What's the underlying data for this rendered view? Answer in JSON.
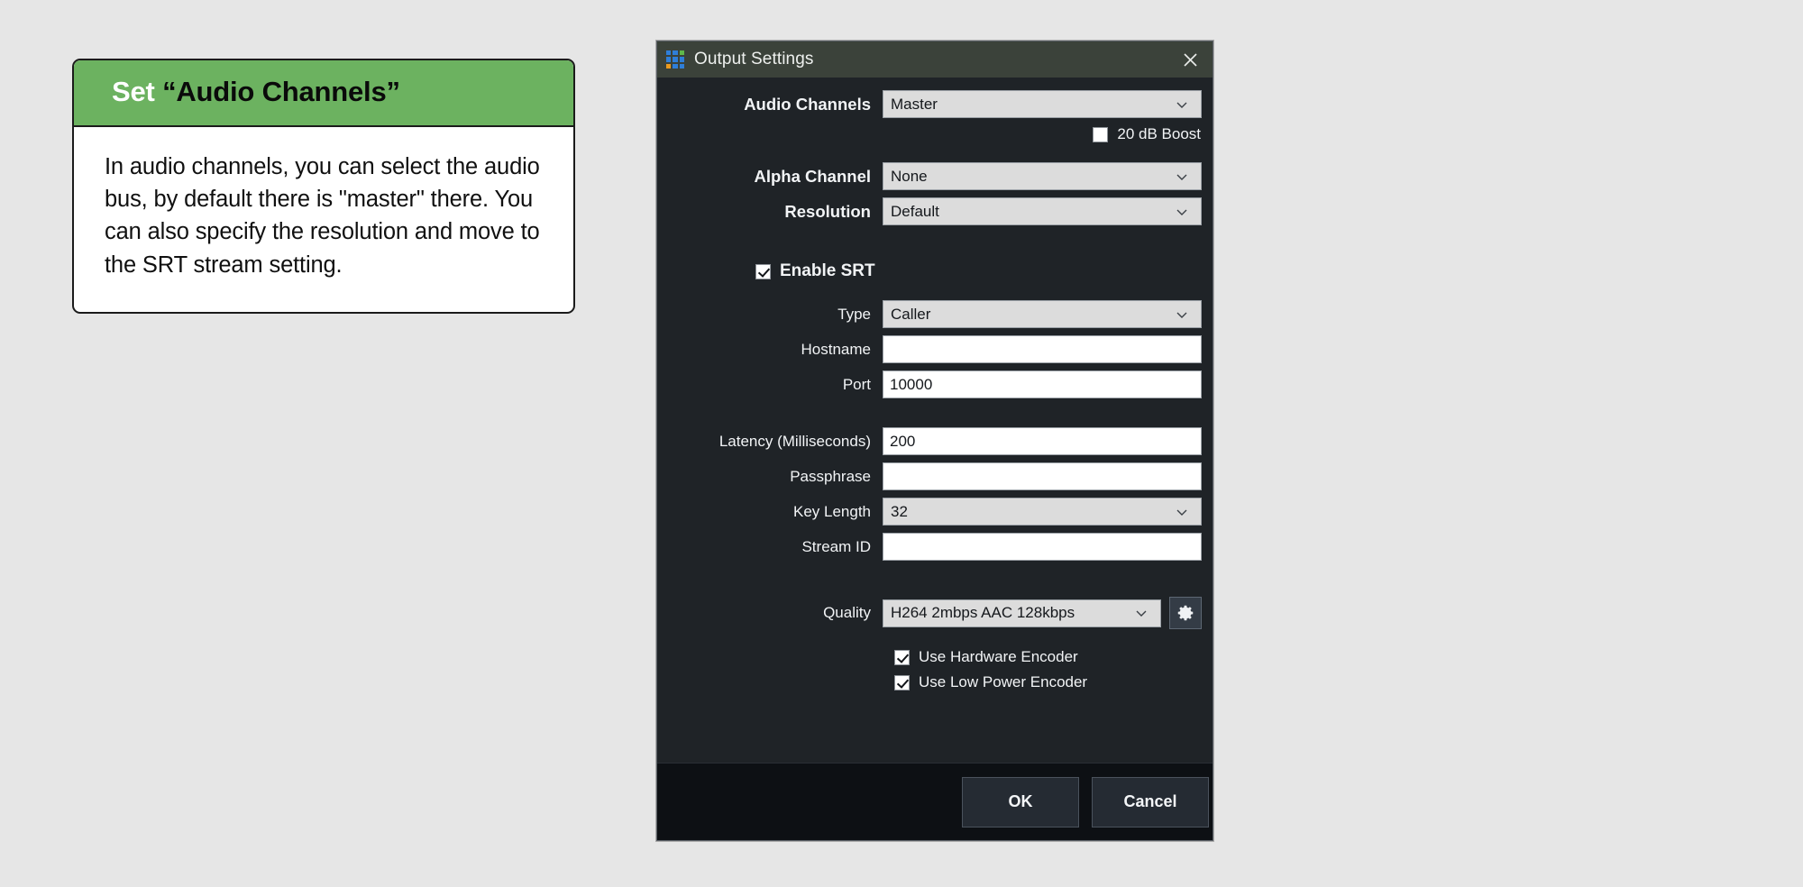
{
  "callout": {
    "heading_prefix": "Set ",
    "heading_quoted": "“Audio Channels”",
    "body": "In audio channels, you can select the audio bus, by default there is \"master\" there. You can also specify the resolution and move to the SRT stream setting."
  },
  "dialog": {
    "title": "Output Settings",
    "app_icon": "grid-3x3-icon",
    "close_icon": "close-icon",
    "icon_colors": [
      "#2f7ed8",
      "#2f7ed8",
      "#5fb84b",
      "#2f7ed8",
      "#2f7ed8",
      "#2f7ed8",
      "#eb9a1e",
      "#2f7ed8",
      "#2f7ed8"
    ],
    "fields": {
      "audio_channels": {
        "label": "Audio Channels",
        "value": "Master",
        "type": "select"
      },
      "db_boost": {
        "label": "20 dB Boost",
        "checked": false
      },
      "alpha_channel": {
        "label": "Alpha Channel",
        "value": "None",
        "type": "select"
      },
      "resolution": {
        "label": "Resolution",
        "value": "Default",
        "type": "select"
      },
      "enable_srt": {
        "label": "Enable SRT",
        "checked": true
      },
      "type": {
        "label": "Type",
        "value": "Caller",
        "type": "select"
      },
      "hostname": {
        "label": "Hostname",
        "value": "",
        "type": "text"
      },
      "port": {
        "label": "Port",
        "value": "10000",
        "type": "text"
      },
      "latency": {
        "label": "Latency (Milliseconds)",
        "value": "200",
        "type": "text"
      },
      "passphrase": {
        "label": "Passphrase",
        "value": "",
        "type": "text"
      },
      "key_length": {
        "label": "Key Length",
        "value": "32",
        "type": "select"
      },
      "stream_id": {
        "label": "Stream ID",
        "value": "",
        "type": "text"
      },
      "quality": {
        "label": "Quality",
        "value": "H264 2mbps AAC 128kbps",
        "type": "select"
      },
      "quality_settings_icon": "gear-icon",
      "use_hardware_encoder": {
        "label": "Use Hardware Encoder",
        "checked": true
      },
      "use_low_power_encoder": {
        "label": "Use Low Power Encoder",
        "checked": true
      }
    },
    "buttons": {
      "ok": "OK",
      "cancel": "Cancel"
    }
  },
  "colors": {
    "accent_green": "#6cb260",
    "titlebar": "#3b423a",
    "dialog_bg": "#1f2327",
    "footer_bg": "#0d1014",
    "page_bg": "#e6e6e6"
  }
}
